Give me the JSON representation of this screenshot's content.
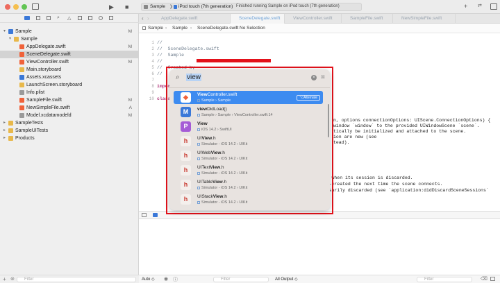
{
  "toolbar": {
    "scheme": "Sample",
    "sep": "❯",
    "device": "iPod touch (7th generation)",
    "status": "Finished running Sample on iPod touch (7th generation)"
  },
  "tabs": [
    "AppDelegate.swift",
    "SceneDelegate.swift",
    "ViewController.swift",
    "SampleFile.swift",
    "NewSimpleFile.swift"
  ],
  "jumpbar": [
    "Sample",
    "Sample",
    "SceneDelegate.swift",
    "No Selection"
  ],
  "navigator": [
    {
      "label": "Sample",
      "badge": "M",
      "indent": 0,
      "icon": "#3a78d8",
      "chev": "▾"
    },
    {
      "label": "Sample",
      "badge": "",
      "indent": 1,
      "icon": "#e8b84a",
      "chev": "▾"
    },
    {
      "label": "AppDelegate.swift",
      "badge": "M",
      "indent": 2,
      "icon": "#f0623a",
      "chev": ""
    },
    {
      "label": "SceneDelegate.swift",
      "badge": "",
      "indent": 2,
      "icon": "#f0623a",
      "chev": ""
    },
    {
      "label": "ViewController.swift",
      "badge": "M",
      "indent": 2,
      "icon": "#f0623a",
      "chev": ""
    },
    {
      "label": "Main.storyboard",
      "badge": "",
      "indent": 2,
      "icon": "#e8b84a",
      "chev": ""
    },
    {
      "label": "Assets.xcassets",
      "badge": "",
      "indent": 2,
      "icon": "#3a78d8",
      "chev": ""
    },
    {
      "label": "LaunchScreen.storyboard",
      "badge": "",
      "indent": 2,
      "icon": "#e8b84a",
      "chev": ""
    },
    {
      "label": "Info.plist",
      "badge": "",
      "indent": 2,
      "icon": "#9a9a9a",
      "chev": ""
    },
    {
      "label": "SampleFile.swift",
      "badge": "M",
      "indent": 2,
      "icon": "#f0623a",
      "chev": ""
    },
    {
      "label": "NewSimpleFile.swift",
      "badge": "A",
      "indent": 2,
      "icon": "#f0623a",
      "chev": ""
    },
    {
      "label": "Model.xcdatamodeld",
      "badge": "M",
      "indent": 2,
      "icon": "#9a9a9a",
      "chev": ""
    },
    {
      "label": "SampleTests",
      "badge": "",
      "indent": 0,
      "icon": "#e8b84a",
      "chev": "▸"
    },
    {
      "label": "SampleUITests",
      "badge": "",
      "indent": 0,
      "icon": "#e8b84a",
      "chev": "▸"
    },
    {
      "label": "Products",
      "badge": "",
      "indent": 0,
      "icon": "#e8b84a",
      "chev": "▸"
    }
  ],
  "code": [
    {
      "n": "1",
      "t": "//",
      "c": "cmt"
    },
    {
      "n": "2",
      "t": "//  SceneDelegate.swift",
      "c": "cmt"
    },
    {
      "n": "3",
      "t": "//  Sample",
      "c": "cmt"
    },
    {
      "n": "4",
      "t": "//",
      "c": "cmt"
    },
    {
      "n": "5",
      "t": "//  Created by",
      "c": "cmt"
    },
    {
      "n": "6",
      "t": "//",
      "c": "cmt"
    },
    {
      "n": "7",
      "t": "",
      "c": ""
    },
    {
      "n": "8",
      "t": "import",
      "c": "kw"
    },
    {
      "n": "9",
      "t": "",
      "c": ""
    },
    {
      "n": "10",
      "t": "class",
      "c": "kw"
    }
  ],
  "code_right": [
    "n, options connectionOptions: UIScene.ConnectionOptions) {",
    "window `window` to the provided UIWindowScene `scene`.",
    "tically be initialized and attached to the scene.",
    "ion are new (see",
    "tead)."
  ],
  "code_right2": [
    ", or when its session is discarded.",
    "e re-created the next time the scene connects.",
    "ecessarily discarded (see `application:didDiscardSceneSessions`"
  ],
  "popup": {
    "query": "view",
    "results": [
      {
        "pre": "",
        "bold": "View",
        "post": "Controller.swift",
        "sub": "Sample › Sample",
        "icon": "swift",
        "color": "#f0623a",
        "glyph": "",
        "badge": "⌥Alternate"
      },
      {
        "pre": "",
        "bold": "view",
        "post": "DidLoad()",
        "sub": "Sample › Sample › ViewController.swift:14",
        "icon": "M",
        "color": "#3a78d8",
        "glyph": "M",
        "badge": ""
      },
      {
        "pre": "",
        "bold": "View",
        "post": "",
        "sub": "iOS 14.2 › SwiftUI",
        "icon": "P",
        "color": "#a55cd6",
        "glyph": "P",
        "badge": ""
      },
      {
        "pre": "UI",
        "bold": "View",
        "post": ".h",
        "sub": "Simulator - iOS 14.2 › UIKit",
        "icon": "h",
        "color": "#c8372d",
        "glyph": "h",
        "badge": ""
      },
      {
        "pre": "UIWeb",
        "bold": "View",
        "post": ".h",
        "sub": "Simulator - iOS 14.2 › UIKit",
        "icon": "h",
        "color": "#c8372d",
        "glyph": "h",
        "badge": ""
      },
      {
        "pre": "UIText",
        "bold": "View",
        "post": ".h",
        "sub": "Simulator - iOS 14.2 › UIKit",
        "icon": "h",
        "color": "#c8372d",
        "glyph": "h",
        "badge": ""
      },
      {
        "pre": "UITable",
        "bold": "View",
        "post": ".h",
        "sub": "Simulator - iOS 14.2 › UIKit",
        "icon": "h",
        "color": "#c8372d",
        "glyph": "h",
        "badge": ""
      },
      {
        "pre": "UIStack",
        "bold": "View",
        "post": ".h",
        "sub": "Simulator - iOS 14.2 › UIKit",
        "icon": "h",
        "color": "#c8372d",
        "glyph": "h",
        "badge": ""
      }
    ]
  },
  "bottom": {
    "filter": "Filter",
    "auto": "Auto ◇",
    "all_output": "All Output ◇"
  }
}
